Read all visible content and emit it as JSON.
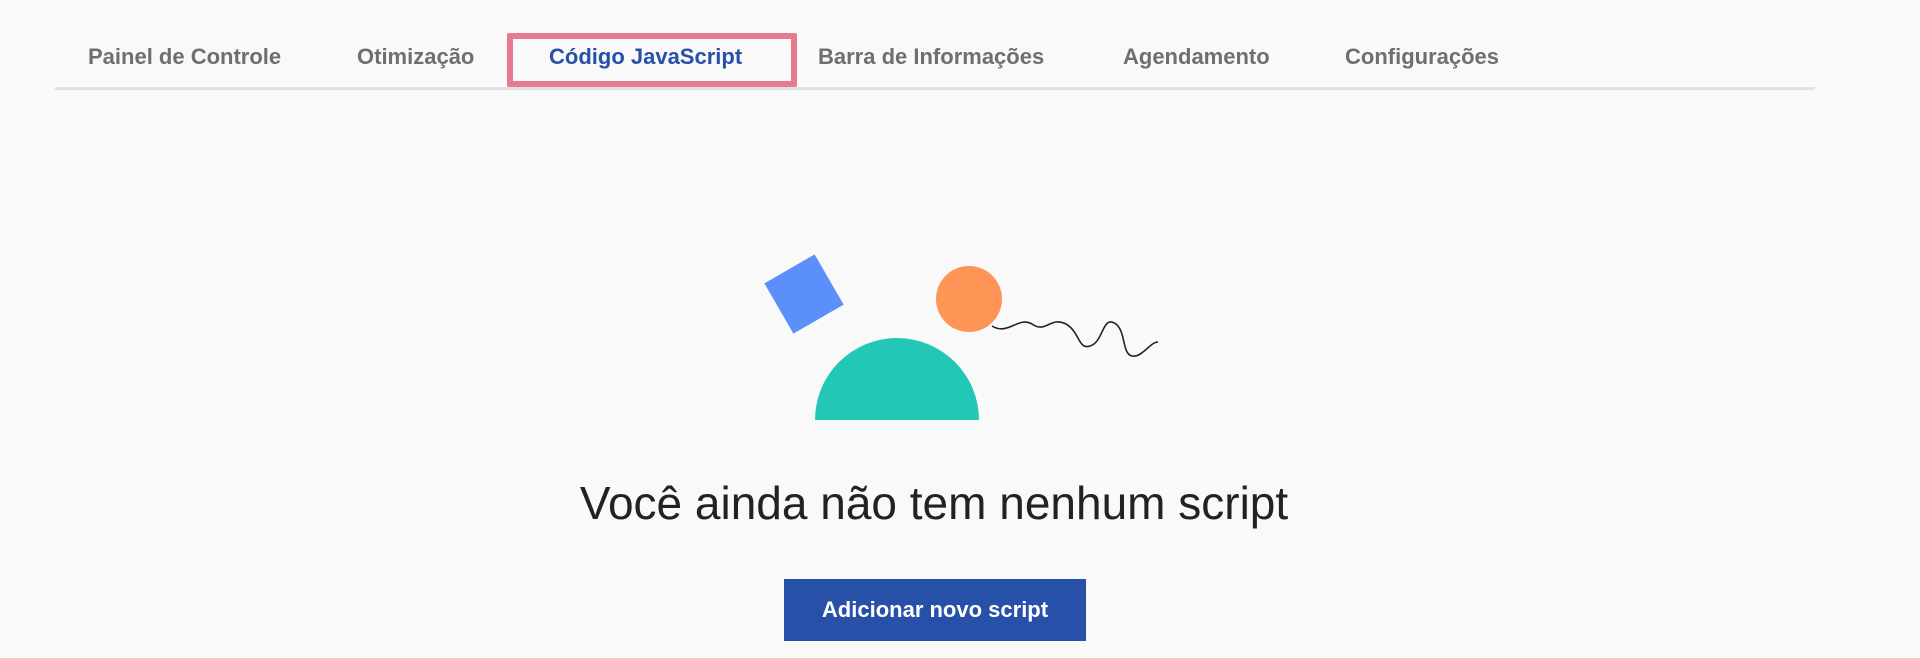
{
  "tabs": [
    {
      "label": "Painel de Controle",
      "active": false
    },
    {
      "label": "Otimização",
      "active": false
    },
    {
      "label": "Código JavaScript",
      "active": true
    },
    {
      "label": "Barra de Informações",
      "active": false
    },
    {
      "label": "Agendamento",
      "active": false
    },
    {
      "label": "Configurações",
      "active": false
    }
  ],
  "empty_state": {
    "title": "Você ainda não tem nenhum script",
    "button_label": "Adicionar novo script"
  },
  "colors": {
    "accent": "#2750a8",
    "highlight": "#e87a8f",
    "square": "#5b8ff9",
    "circle": "#ff9457",
    "semicircle": "#22c7b6"
  }
}
